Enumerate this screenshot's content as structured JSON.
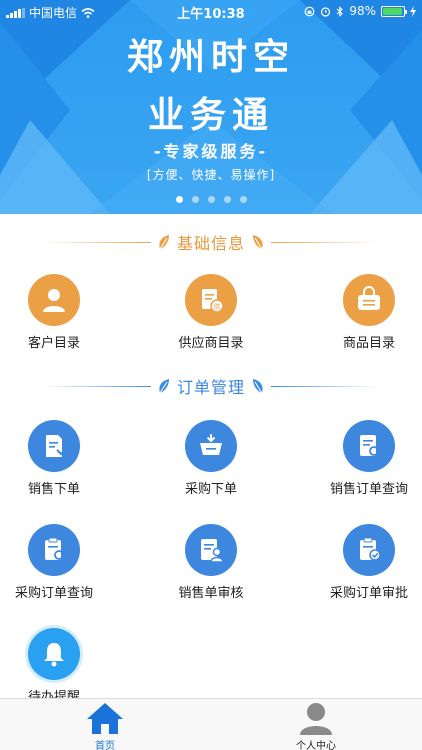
{
  "status_bar": {
    "carrier": "中国电信",
    "time": "上午10:38",
    "battery": "98%"
  },
  "banner": {
    "title_line1": "郑州时空",
    "title_line2": "业务通",
    "tagline": "-专家级服务-",
    "subtitle": "[方便、快捷、易操作]",
    "page_count": 5,
    "active_page": 1
  },
  "sections": {
    "basic_info": {
      "title": "基础信息",
      "color": "#eca046",
      "items": [
        {
          "label": "客户目录",
          "icon": "customer-icon"
        },
        {
          "label": "供应商目录",
          "icon": "supplier-icon"
        },
        {
          "label": "商品目录",
          "icon": "product-icon"
        }
      ]
    },
    "order_mgmt": {
      "title": "订单管理",
      "color": "#3d87df",
      "items": [
        {
          "label": "销售下单",
          "icon": "sales-order-icon"
        },
        {
          "label": "采购下单",
          "icon": "purchase-order-icon"
        },
        {
          "label": "销售订单查询",
          "icon": "sales-query-icon"
        },
        {
          "label": "采购订单查询",
          "icon": "purchase-query-icon"
        },
        {
          "label": "销售单审核",
          "icon": "sales-review-icon"
        },
        {
          "label": "采购订单审批",
          "icon": "purchase-approve-icon"
        },
        {
          "label": "待办提醒",
          "icon": "bell-icon"
        }
      ]
    }
  },
  "tab_bar": {
    "home": "首页",
    "profile": "个人中心",
    "active_color": "#1a73d9"
  }
}
